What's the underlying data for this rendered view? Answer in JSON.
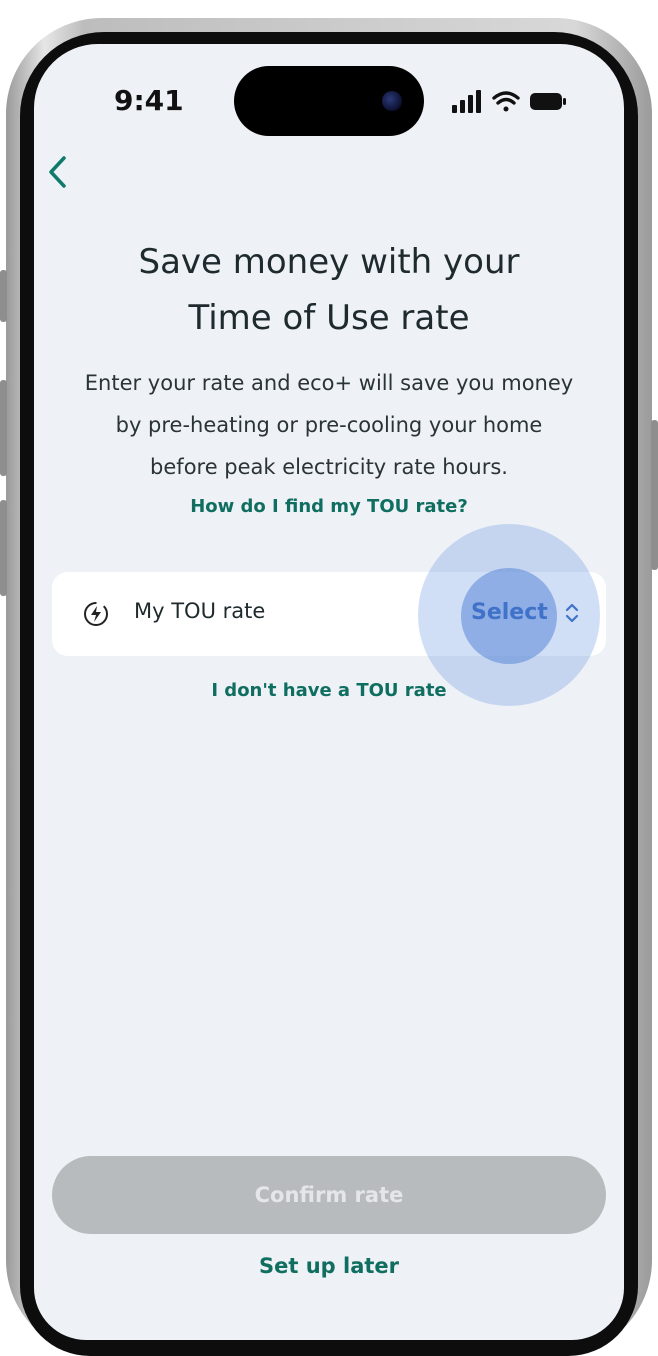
{
  "status_bar": {
    "time": "9:41"
  },
  "navigation": {
    "back_icon": "chevron-left-icon"
  },
  "header": {
    "title_line1": "Save money with your",
    "title_line2": "Time of Use rate"
  },
  "description": {
    "line1": "Enter your rate and eco+ will save you money",
    "line2": "by pre-heating or pre-cooling your home",
    "line3": "before peak electricity rate hours."
  },
  "links": {
    "find_rate": "How do I find my TOU rate?",
    "no_rate": "I don't have a TOU rate",
    "set_up_later": "Set up later"
  },
  "rate_field": {
    "icon": "lightning-clock-icon",
    "label": "My TOU rate",
    "select_label": "Select",
    "select_icon": "up-down-chevron-icon"
  },
  "actions": {
    "confirm_label": "Confirm rate"
  },
  "colors": {
    "accent": "#0f6e60",
    "select_blue": "#3f72c8",
    "screen_bg": "#eef2f6",
    "disabled_button": "#b8bbbd"
  }
}
